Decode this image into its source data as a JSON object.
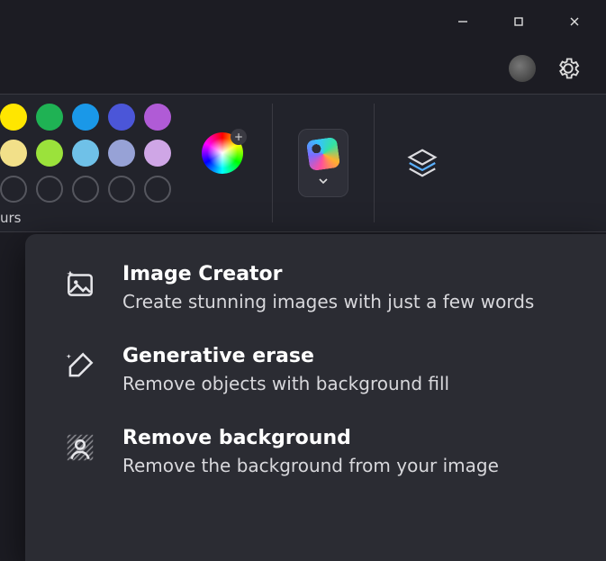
{
  "window_controls": {
    "minimize_title": "Minimize",
    "maximize_title": "Maximize",
    "close_title": "Close"
  },
  "toolbar": {
    "colours_label": "urs",
    "swatches_row1": [
      "#ffe600",
      "#1fb254",
      "#1a98e8",
      "#4b56d8",
      "#b05bd6"
    ],
    "swatches_row2": [
      "#f2e089",
      "#9be23b",
      "#6fc1e8",
      "#97a2d6",
      "#cfa6e6"
    ],
    "swatches_row3_empty_count": 5,
    "color_picker_title": "Edit colour",
    "ai_button_title": "Copilot",
    "layers_title": "Layers"
  },
  "dropdown": {
    "items": [
      {
        "icon": "image-creator-icon",
        "title": "Image Creator",
        "desc": "Create stunning images with just a few words"
      },
      {
        "icon": "generative-erase-icon",
        "title": "Generative erase",
        "desc": "Remove objects with background fill"
      },
      {
        "icon": "remove-background-icon",
        "title": "Remove background",
        "desc": "Remove the background from your image"
      }
    ]
  }
}
